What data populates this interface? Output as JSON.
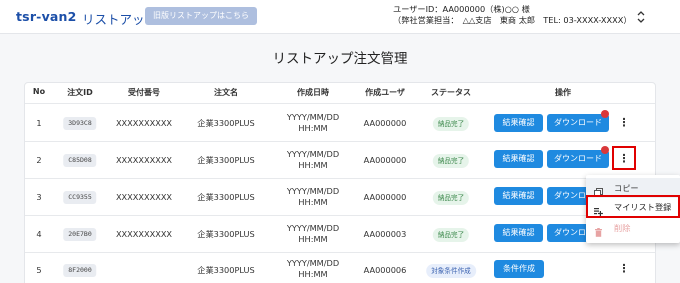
{
  "header": {
    "brand": "tsr-van2",
    "nav_link": "リストアップ",
    "old_button": "旧版リストアップはこちら",
    "user_line1": "ユーザーID：AA000000（株)○○ 様",
    "user_line2": "（弊社営業担当：　△△支店　東商 太郎　TEL: 03-XXXX-XXXX）"
  },
  "page_title": "リストアップ注文管理",
  "table": {
    "headers": [
      "No",
      "注文ID",
      "受付番号",
      "注文名",
      "作成日時",
      "作成ユーザ",
      "ステータス",
      "操作"
    ],
    "rows": [
      {
        "no": "1",
        "order_id": "3D93C8",
        "receipt": "XXXXXXXXXX",
        "name": "企業3300PLUS",
        "date": "YYYY/MM/DD",
        "time": "HH:MM",
        "user": "AA000000",
        "status": "納品完了",
        "actions": [
          "結果確認",
          "ダウンロード"
        ]
      },
      {
        "no": "2",
        "order_id": "C85D08",
        "receipt": "XXXXXXXXXX",
        "name": "企業3300PLUS",
        "date": "YYYY/MM/DD",
        "time": "HH:MM",
        "user": "AA000000",
        "status": "納品完了",
        "actions": [
          "結果確認",
          "ダウンロード"
        ]
      },
      {
        "no": "3",
        "order_id": "CC9355",
        "receipt": "XXXXXXXXXX",
        "name": "企業3300PLUS",
        "date": "YYYY/MM/DD",
        "time": "HH:MM",
        "user": "AA000000",
        "status": "納品完了",
        "actions": [
          "結果確認",
          "ダウンロード"
        ]
      },
      {
        "no": "4",
        "order_id": "20E7B0",
        "receipt": "XXXXXXXXXX",
        "name": "企業3300PLUS",
        "date": "YYYY/MM/DD",
        "time": "HH:MM",
        "user": "AA000003",
        "status": "納品完了",
        "actions": [
          "結果確認",
          "ダウンロード"
        ]
      },
      {
        "no": "5",
        "order_id": "8F2000",
        "receipt": "",
        "name": "企業3300PLUS",
        "date": "YYYY/MM/DD",
        "time": "HH:MM",
        "user": "AA000006",
        "status": "対象条件作成",
        "actions": [
          "条件作成"
        ]
      }
    ]
  },
  "context_menu": {
    "copy": "コピー",
    "mylist": "マイリスト登録",
    "delete": "削除"
  },
  "colors": {
    "brand": "#1c4fa8",
    "button": "#1f8ae0",
    "highlight": "#e00000",
    "badge_dot": "#d9383a"
  }
}
